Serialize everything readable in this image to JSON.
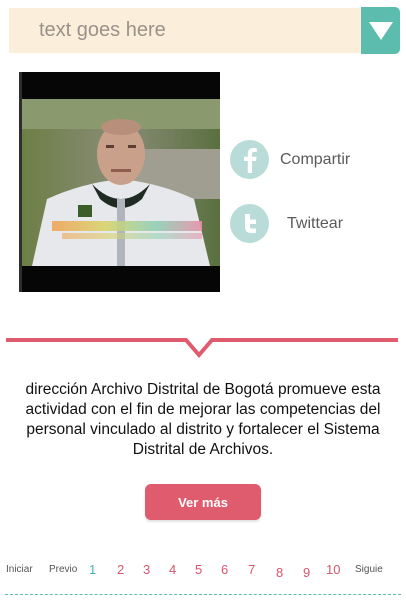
{
  "search": {
    "placeholder": "text goes here",
    "dropdown_icon": "triangle-down-icon"
  },
  "video": {
    "thumbnail_alt": "video-thumbnail"
  },
  "share": {
    "facebook_label": "Compartir",
    "facebook_icon": "facebook-icon",
    "twitter_label": "Twittear",
    "twitter_icon": "twitter-icon"
  },
  "description": "dirección Archivo Distrital de Bogotá promueve esta actividad con el fin de mejorar las competencias del personal vinculado al distrito y fortalecer el Sistema Distrital de Archivos.",
  "more_button": "Ver más",
  "pagination": {
    "first": "Iniciar",
    "prev": "Previo",
    "pages": [
      "1",
      "2",
      "3",
      "4",
      "5",
      "6",
      "7",
      "8",
      "9",
      "10"
    ],
    "current": "1",
    "next": "Siguie"
  },
  "colors": {
    "teal": "#5cbcae",
    "pink": "#df5c6e",
    "cream": "#fbefdc"
  }
}
